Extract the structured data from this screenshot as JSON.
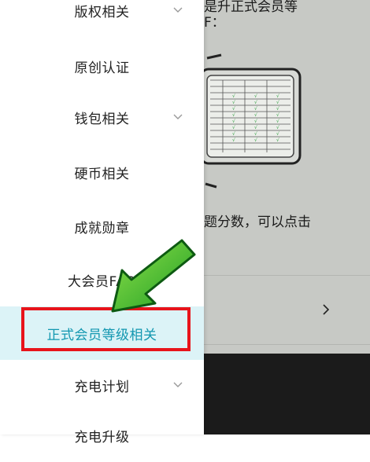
{
  "background": {
    "text_line1": "是升正式会员等",
    "text_line2": "F：",
    "text_line3": "题分数，可以点击",
    "dash": "＿"
  },
  "menu": {
    "items": [
      {
        "label": "版权相关",
        "has_chevron": true
      },
      {
        "label": "原创认证",
        "has_chevron": false
      },
      {
        "label": "钱包相关",
        "has_chevron": true
      },
      {
        "label": "硬币相关",
        "has_chevron": false
      },
      {
        "label": "成就勋章",
        "has_chevron": false
      },
      {
        "label": "大会员FAQ",
        "has_chevron": false
      },
      {
        "label": "正式会员等级相关",
        "has_chevron": false,
        "active": true
      },
      {
        "label": "充电计划",
        "has_chevron": true
      },
      {
        "label": "充电升级",
        "has_chevron": false
      }
    ]
  },
  "colors": {
    "active_text": "#1297b0",
    "active_bg": "#dcf3f7",
    "highlight_border": "#e8141b",
    "arrow": "#2fc230"
  },
  "icons": {
    "chevron": "chevron-down-icon",
    "arrow": "green-pointer-arrow",
    "right": "chevron-right-icon"
  }
}
